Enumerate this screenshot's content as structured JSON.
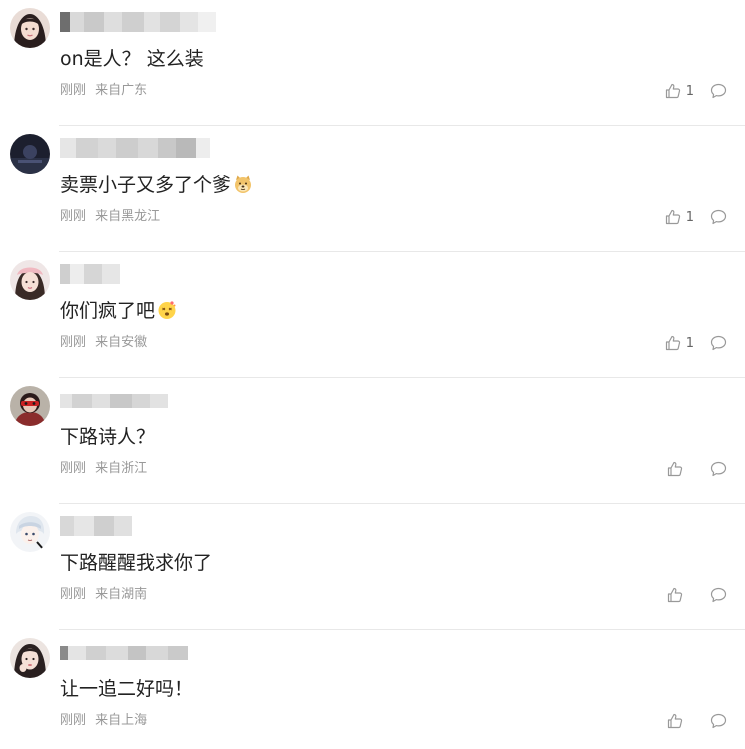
{
  "comments": [
    {
      "avatar": "avatar-1",
      "text": "on是人？ 这么装",
      "emoji": null,
      "time": "刚刚",
      "location": "来自广东",
      "likes": "1"
    },
    {
      "avatar": "avatar-2",
      "text": "卖票小子又多了个爹",
      "emoji": "doge-icon",
      "time": "刚刚",
      "location": "来自黑龙江",
      "likes": "1"
    },
    {
      "avatar": "avatar-3",
      "text": "你们疯了吧",
      "emoji": "dizzy-face-icon",
      "time": "刚刚",
      "location": "来自安徽",
      "likes": "1"
    },
    {
      "avatar": "avatar-4",
      "text": "下路诗人？",
      "emoji": null,
      "time": "刚刚",
      "location": "来自浙江",
      "likes": ""
    },
    {
      "avatar": "avatar-5",
      "text": "下路醒醒我求你了",
      "emoji": null,
      "time": "刚刚",
      "location": "来自湖南",
      "likes": ""
    },
    {
      "avatar": "avatar-6",
      "text": "让一追二好吗！",
      "emoji": null,
      "time": "刚刚",
      "location": "来自上海",
      "likes": ""
    }
  ],
  "colors": {
    "text": "#222222",
    "meta": "#999999",
    "divider": "#e8e8e8",
    "icon": "#999999"
  }
}
